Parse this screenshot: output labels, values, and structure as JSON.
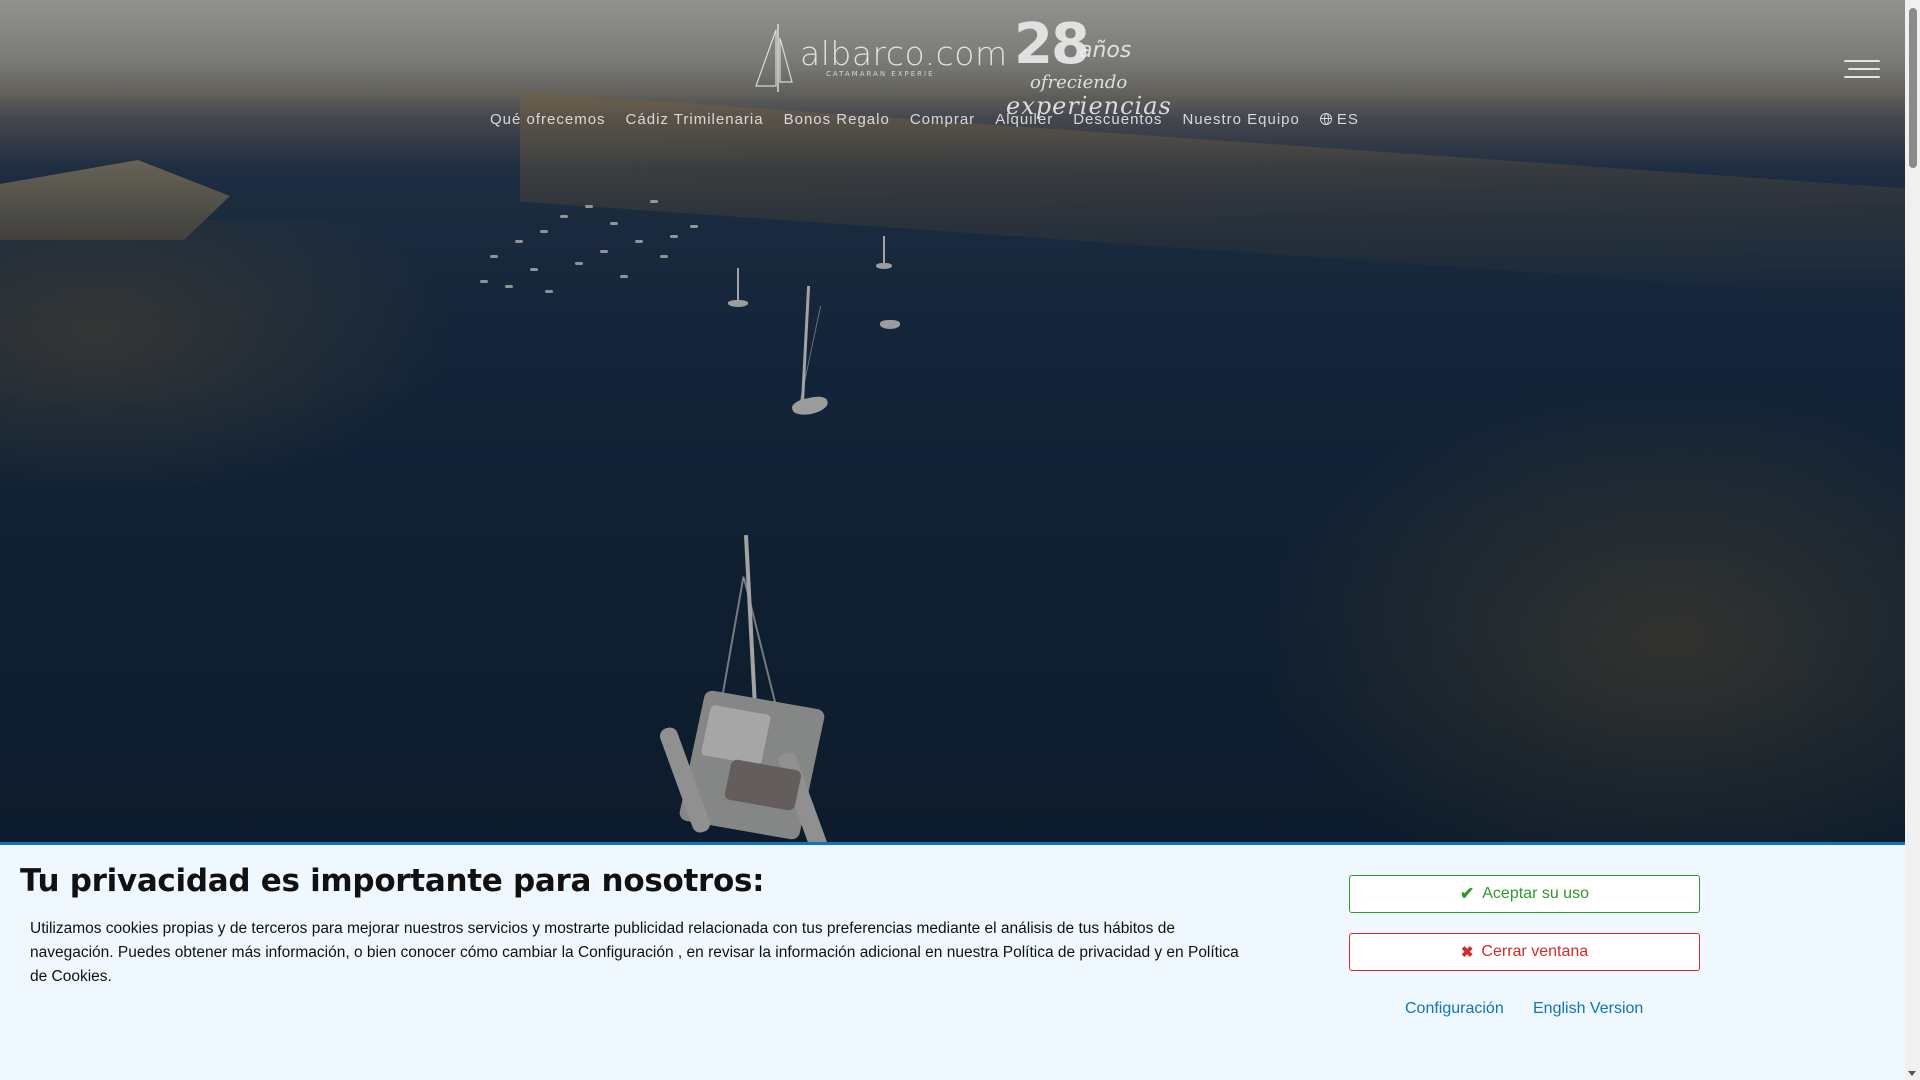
{
  "header": {
    "logo_text": "albarco.com",
    "logo_sub": "CATAMARAN EXPERIE",
    "years_number": "28",
    "years_label": "años",
    "tagline_line1": "ofreciendo",
    "tagline_line2": "experiencias"
  },
  "nav": {
    "items": [
      "Qué ofrecemos",
      "Cádiz Trimilenaria",
      "Bonos Regalo",
      "Comprar",
      "Alquiler",
      "Descuentos",
      "Nuestro Equipo"
    ],
    "language": "ES"
  },
  "cookie_banner": {
    "title": "Tu privacidad es importante para nosotros:",
    "text": "Utilizamos cookies propias y de terceros para mejorar nuestros servicios y mostrarte publicidad relacionada con tus preferencias mediante el análisis de tus hábitos de navegación. Puedes obtener más información, o bien conocer cómo cambiar la Configuración , en revisar la información adicional en nuestra Política de privacidad y en Política de Cookies.",
    "accept_label": "Aceptar su uso",
    "close_label": "Cerrar ventana",
    "config_link": "Configuración",
    "english_link": "English Version"
  },
  "colors": {
    "accent_blue": "#1273b6",
    "accept_green": "#2c9a2c",
    "close_red": "#cf2d2d",
    "banner_bg": "#eff8ff"
  },
  "icons": [
    "sail-logo-icon",
    "globe-icon",
    "hamburger-menu-icon",
    "check-icon",
    "close-x-icon"
  ]
}
